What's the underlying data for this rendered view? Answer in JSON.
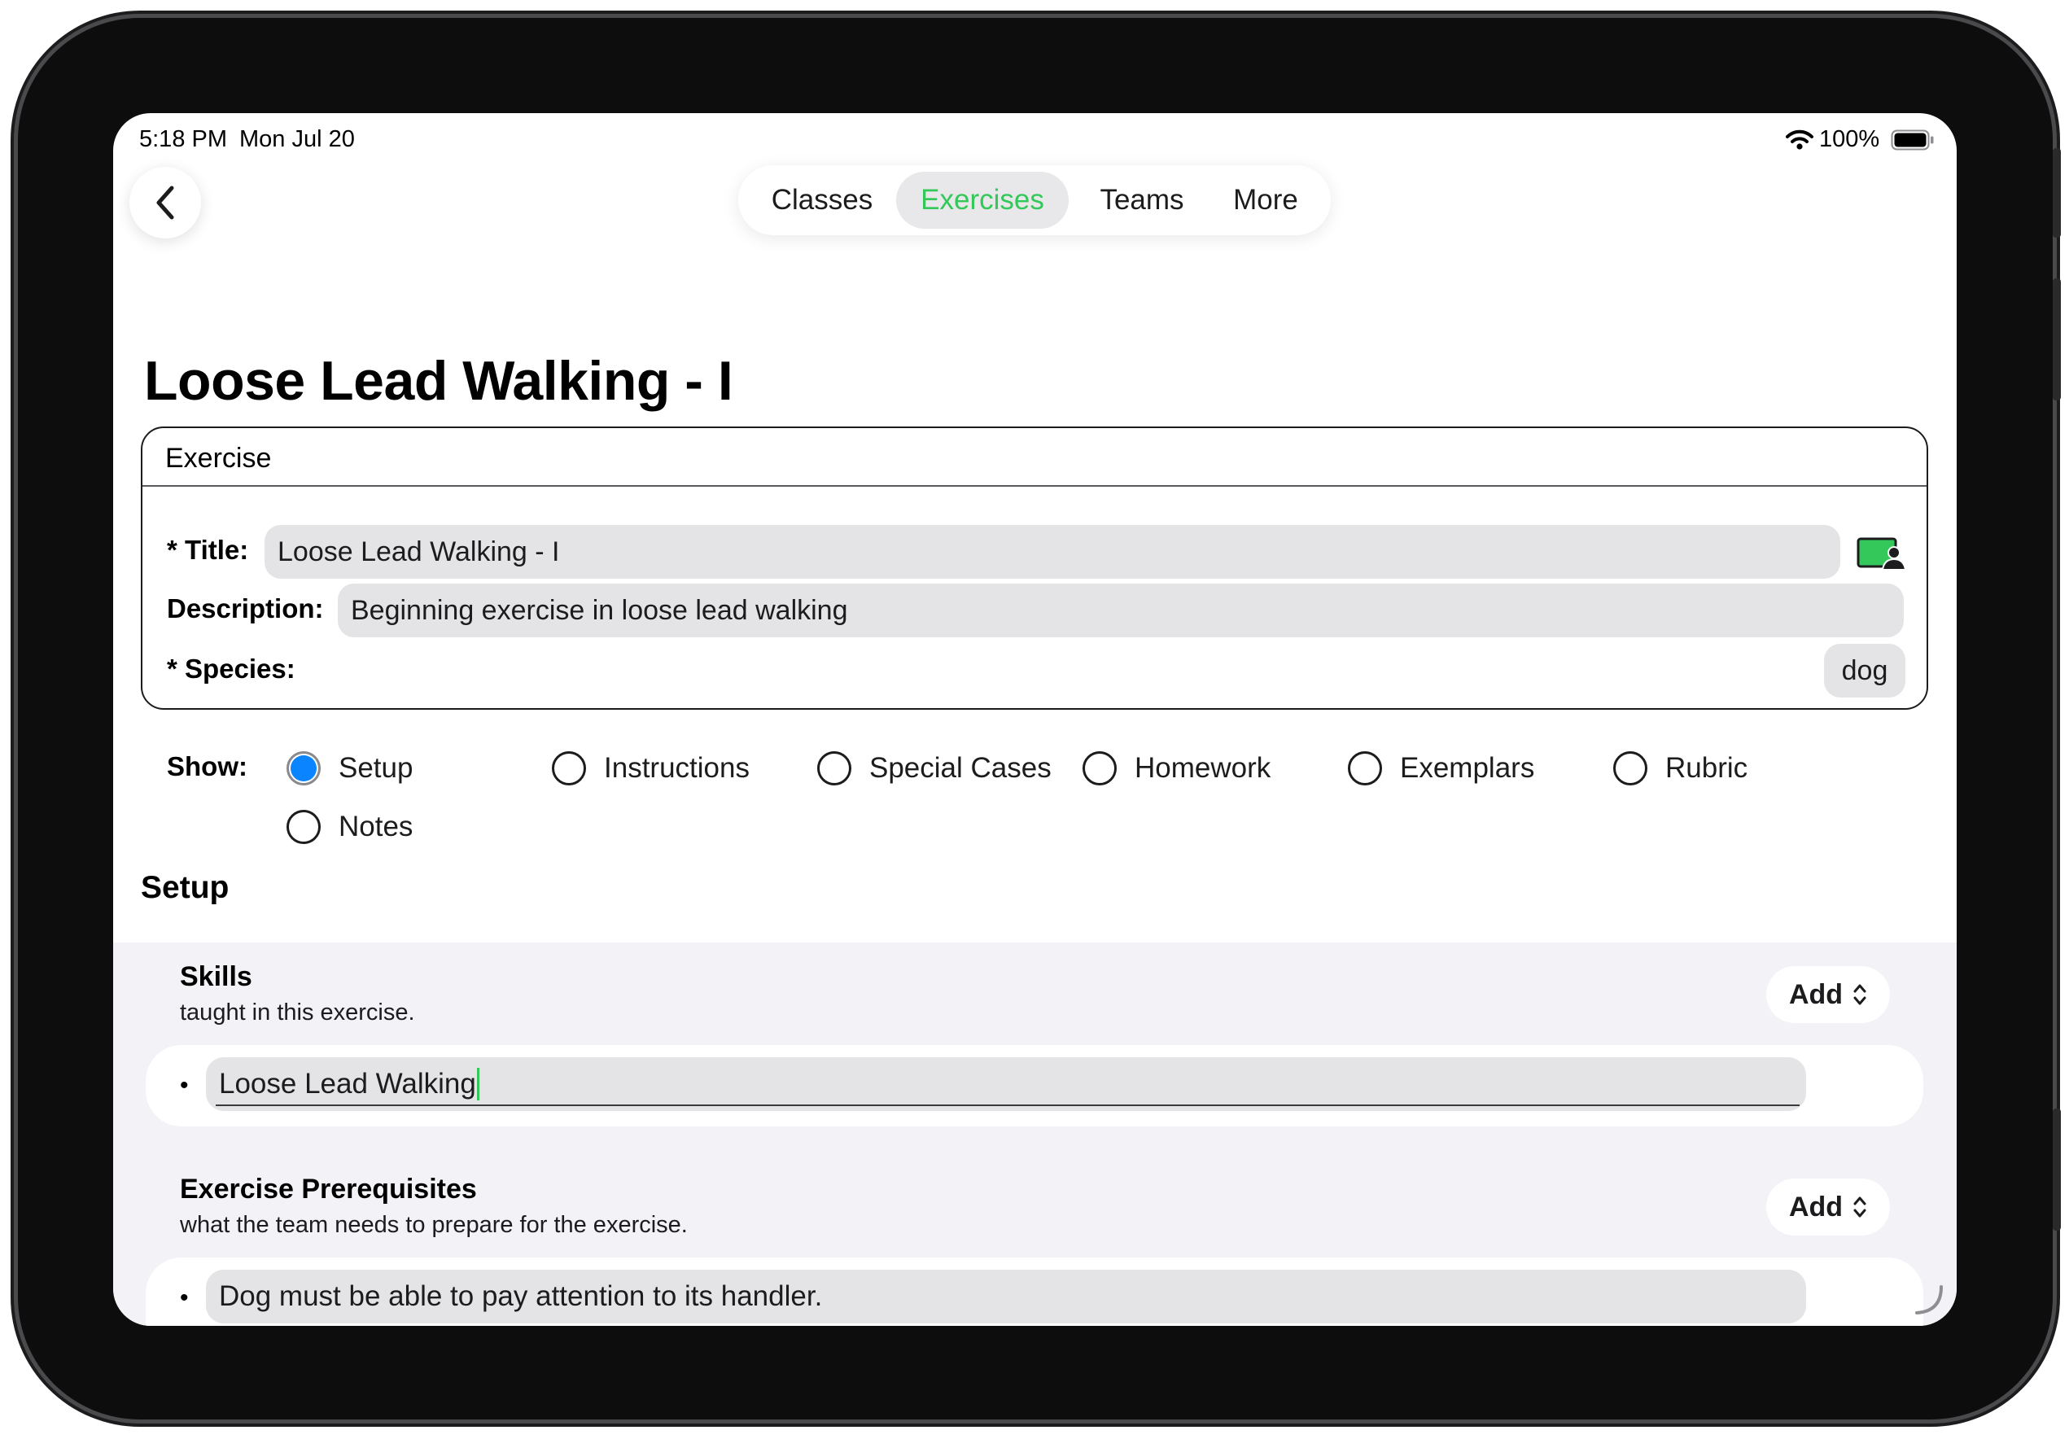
{
  "status_bar": {
    "time": "5:18 PM",
    "date": "Mon Jul 20",
    "battery": "100%"
  },
  "nav": {
    "tabs": [
      {
        "label": "Classes",
        "active": false
      },
      {
        "label": "Exercises",
        "active": true
      },
      {
        "label": "Teams",
        "active": false
      },
      {
        "label": "More",
        "active": false
      }
    ]
  },
  "page_title": "Loose Lead Walking - I",
  "exercise_card": {
    "header": "Exercise",
    "title_label": "* Title:",
    "title_value": "Loose Lead Walking - I",
    "description_label": "Description:",
    "description_value": "Beginning exercise in loose lead walking",
    "species_label": "* Species:",
    "species_value": "dog"
  },
  "show": {
    "label": "Show:",
    "options": [
      {
        "label": "Setup",
        "selected": true
      },
      {
        "label": "Instructions",
        "selected": false
      },
      {
        "label": "Special Cases",
        "selected": false
      },
      {
        "label": "Homework",
        "selected": false
      },
      {
        "label": "Exemplars",
        "selected": false
      },
      {
        "label": "Rubric",
        "selected": false
      },
      {
        "label": "Notes",
        "selected": false
      }
    ]
  },
  "setup": {
    "title": "Setup",
    "skills": {
      "title": "Skills",
      "subtitle": "taught in this exercise.",
      "add_label": "Add",
      "items": [
        "Loose Lead Walking"
      ]
    },
    "prerequisites": {
      "title": "Exercise Prerequisites",
      "subtitle": "what the team needs to prepare for the exercise.",
      "add_label": "Add",
      "items": [
        "Dog must be able to pay attention to its handler."
      ]
    }
  },
  "colors": {
    "accent_green": "#34c759",
    "radio_blue": "#0a84ff",
    "panel_gray": "#f2f2f7",
    "field_gray": "#e4e4e6"
  }
}
